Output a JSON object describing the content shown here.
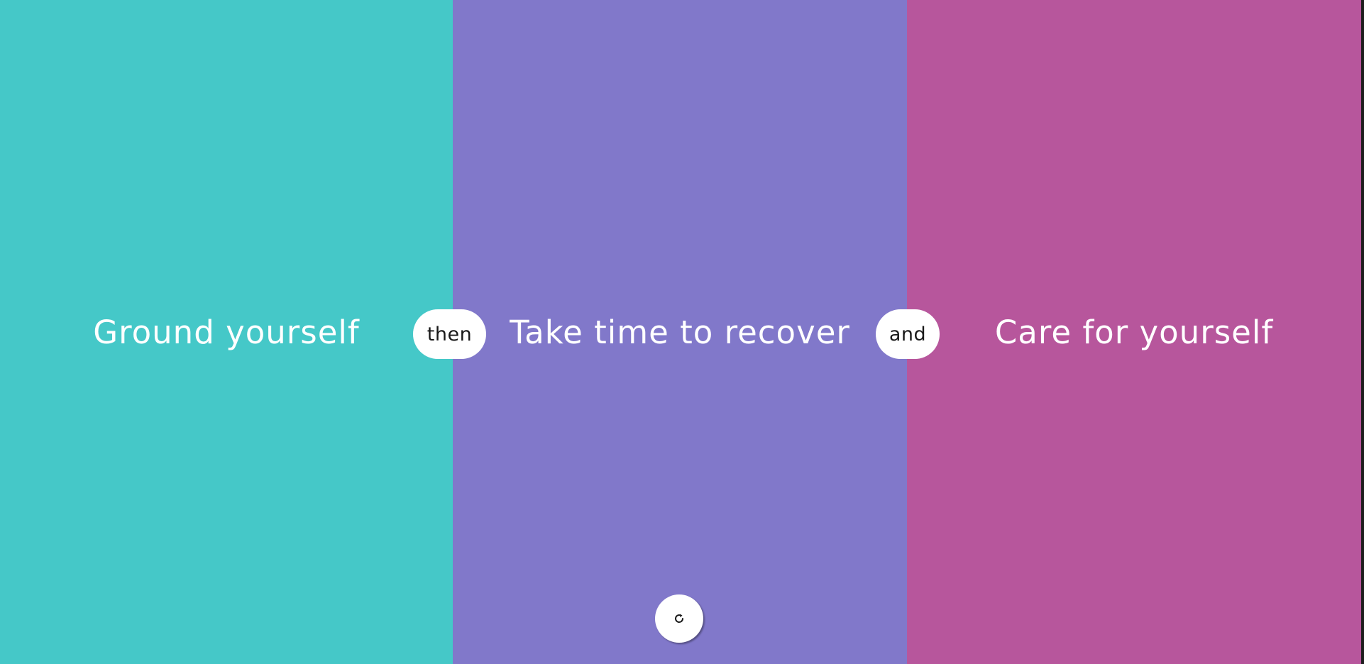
{
  "panels": [
    {
      "label": "Ground yourself",
      "color": "#45C8C8"
    },
    {
      "label": "Take time to recover",
      "color": "#8178CA"
    },
    {
      "label": "Care for yourself",
      "color": "#B7569C"
    }
  ],
  "connectors": [
    {
      "label": "then"
    },
    {
      "label": "and"
    }
  ],
  "refresh_button": {
    "icon": "refresh-icon"
  }
}
